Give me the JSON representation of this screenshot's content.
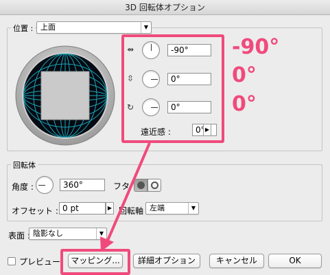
{
  "window": {
    "title": "3D 回転体オプション"
  },
  "position": {
    "label": "位置 :",
    "preset": "上面",
    "x_rotation": "-90°",
    "y_rotation": "0°",
    "z_rotation": "0°",
    "perspective_label": "遠近感 :",
    "perspective": "0°"
  },
  "annotations": {
    "x": "-90°",
    "y": "0°",
    "z": "0°",
    "accent_color": "#f04a7c"
  },
  "revolve": {
    "group_label": "回転体",
    "angle_label": "角度 :",
    "angle": "360°",
    "cap_label": "フタ",
    "offset_label": "オフセット :",
    "offset": "0 pt",
    "axis_label": "回転軸",
    "axis": "左端"
  },
  "surface": {
    "label": "表面 :",
    "value": "陰影なし"
  },
  "footer": {
    "preview_label": "プレビュー",
    "mapping_button": "マッピング...",
    "more_options_button": "詳細オプション",
    "cancel_button": "キャンセル",
    "ok_button": "OK"
  }
}
